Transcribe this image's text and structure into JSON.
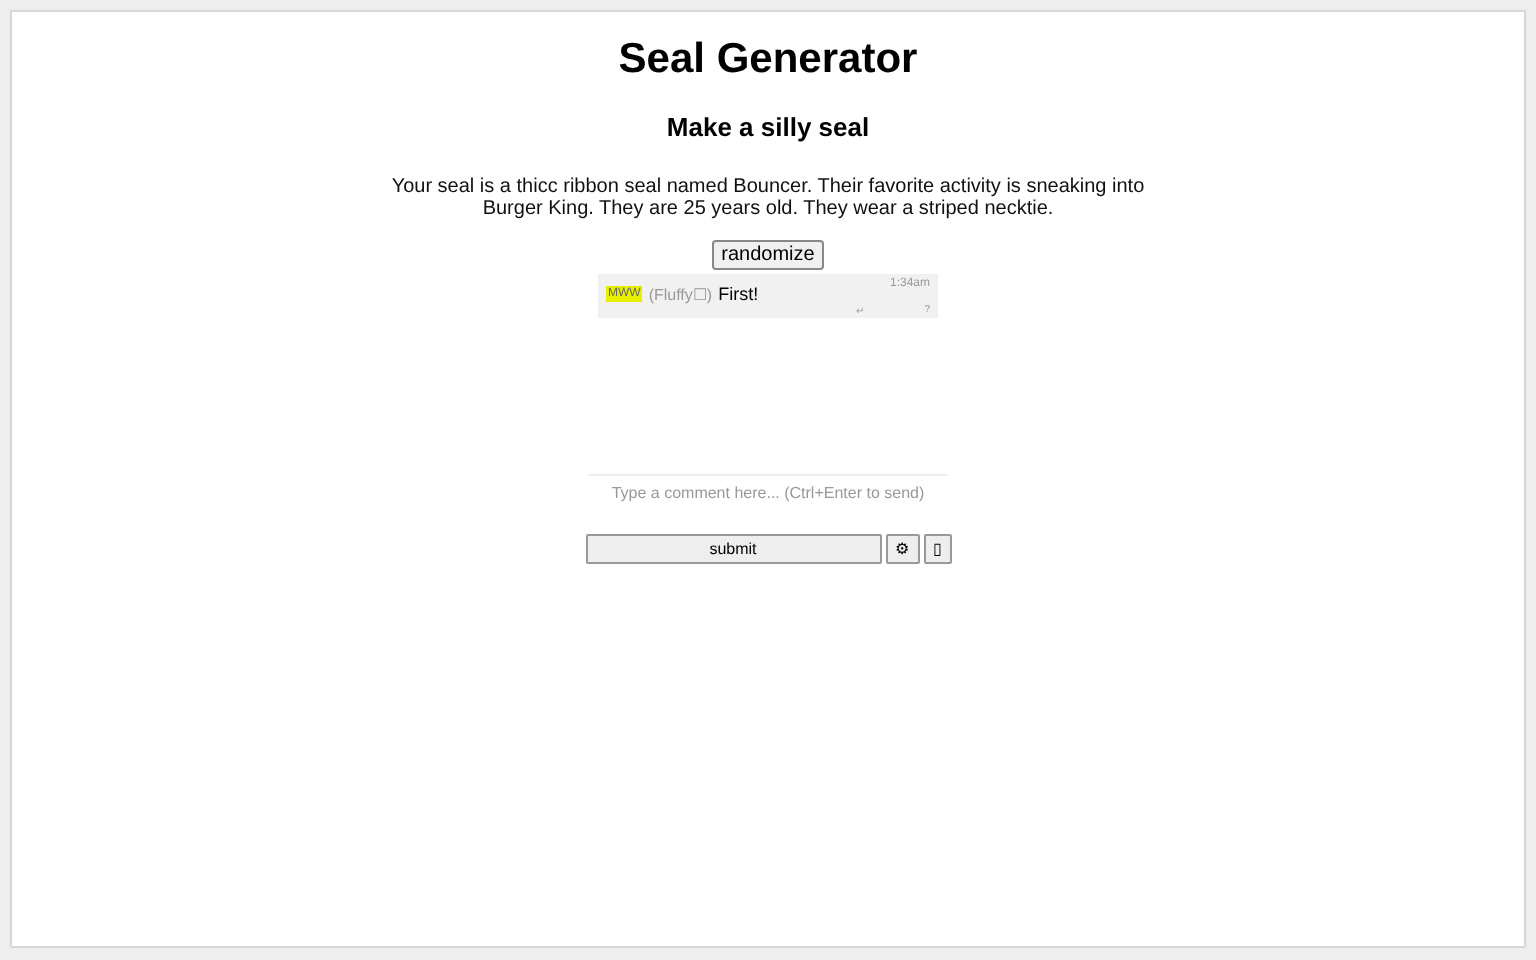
{
  "title": "Seal Generator",
  "subtitle": "Make a silly seal",
  "description": "Your seal is a thicc ribbon seal named Bouncer. Their favorite activity is sneaking into Burger King. They are 25 years old. They wear a striped necktie.",
  "randomize_button": "randomize",
  "comments": [
    {
      "tag": "MWW",
      "author": "(Fluffy☐)",
      "text": "First!",
      "time": "1:34am",
      "reply": "↵",
      "flag": "?"
    }
  ],
  "comment_box": {
    "placeholder": "Type a comment here... (Ctrl+Enter to send)"
  },
  "buttons": {
    "submit": "submit",
    "settings": "⚙",
    "extra": "▯"
  }
}
